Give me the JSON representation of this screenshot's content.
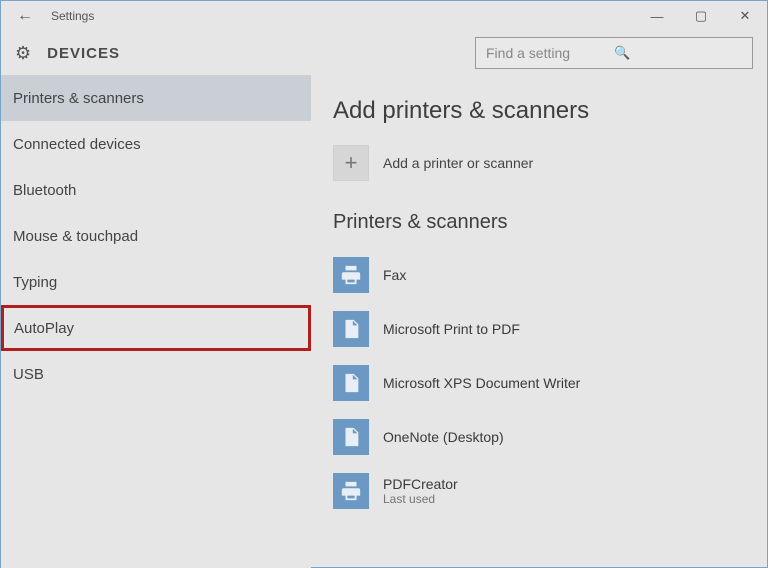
{
  "window": {
    "title": "Settings"
  },
  "header": {
    "page_title": "DEVICES"
  },
  "search": {
    "placeholder": "Find a setting"
  },
  "sidebar": {
    "items": [
      {
        "label": "Printers & scanners",
        "selected": true,
        "highlighted": false
      },
      {
        "label": "Connected devices",
        "selected": false,
        "highlighted": false
      },
      {
        "label": "Bluetooth",
        "selected": false,
        "highlighted": false
      },
      {
        "label": "Mouse & touchpad",
        "selected": false,
        "highlighted": false
      },
      {
        "label": "Typing",
        "selected": false,
        "highlighted": false
      },
      {
        "label": "AutoPlay",
        "selected": false,
        "highlighted": true
      },
      {
        "label": "USB",
        "selected": false,
        "highlighted": false
      }
    ]
  },
  "main": {
    "section1_title": "Add printers & scanners",
    "add_label": "Add a printer or scanner",
    "section2_title": "Printers & scanners",
    "devices": [
      {
        "name": "Fax",
        "sub": "",
        "icon": "printer"
      },
      {
        "name": "Microsoft Print to PDF",
        "sub": "",
        "icon": "document"
      },
      {
        "name": "Microsoft XPS Document Writer",
        "sub": "",
        "icon": "document"
      },
      {
        "name": "OneNote (Desktop)",
        "sub": "",
        "icon": "document"
      },
      {
        "name": "PDFCreator",
        "sub": "Last used",
        "icon": "printer"
      }
    ]
  }
}
